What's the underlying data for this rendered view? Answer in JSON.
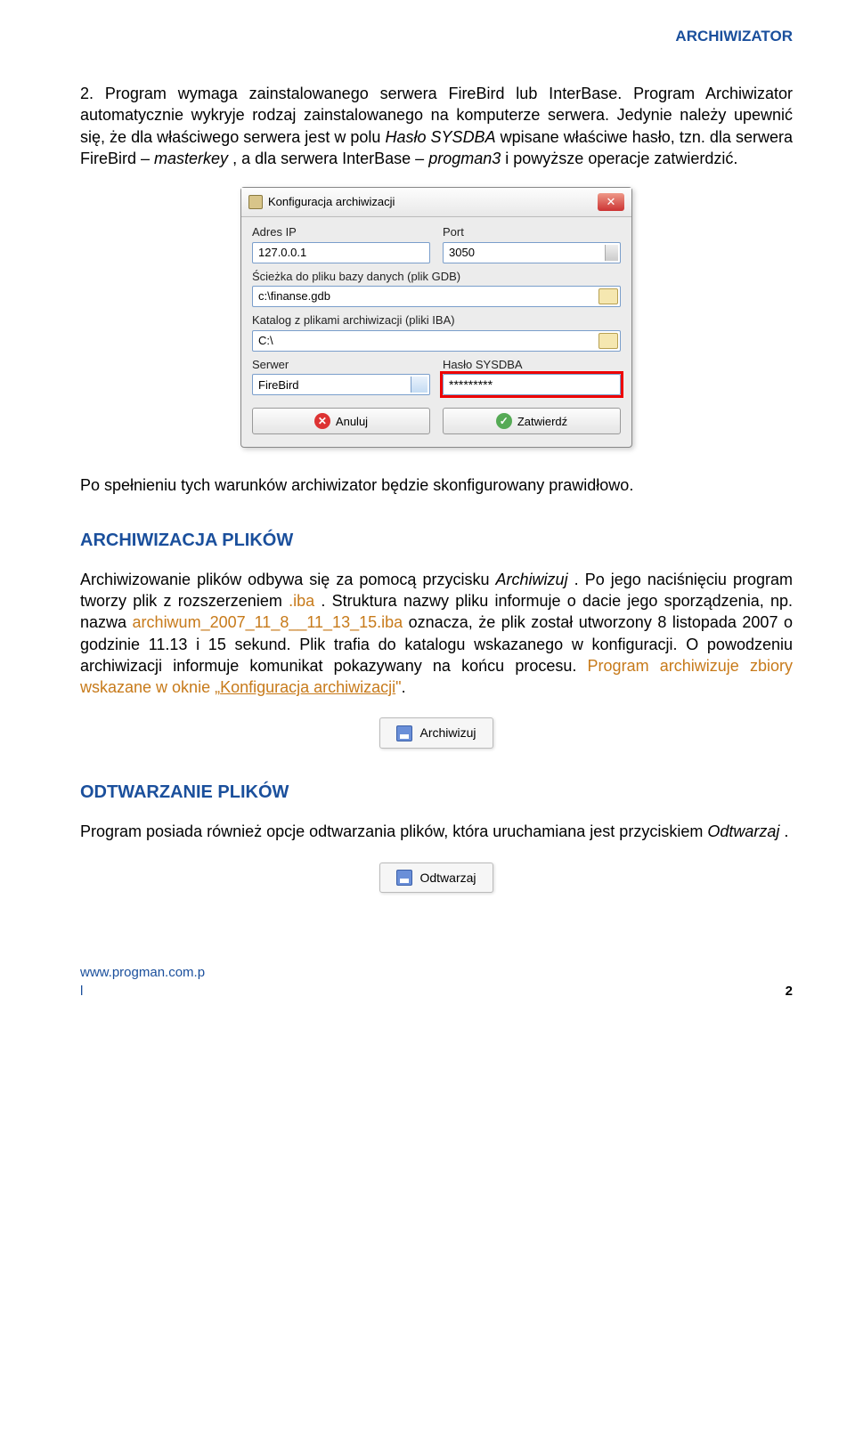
{
  "header": {
    "right": "ARCHIWIZATOR"
  },
  "p1_prefix": "2. Program wymaga zainstalowanego serwera FireBird lub InterBase. Program Archiwizator automatycznie wykryje rodzaj zainstalowanego na komputerze serwera. Jedynie należy upewnić się, że dla właściwego serwera jest w polu ",
  "p1_i1": "Hasło SYSDBA",
  "p1_mid1": " wpisane właściwe hasło, tzn. dla serwera FireBird – ",
  "p1_i2": "masterkey",
  "p1_mid2": ", a dla serwera InterBase – ",
  "p1_i3": "progman3",
  "p1_suffix": " i powyższe operacje zatwierdzić.",
  "dialog": {
    "title": "Konfiguracja archiwizacji",
    "lbl_ip": "Adres IP",
    "val_ip": "127.0.0.1",
    "lbl_port": "Port",
    "val_port": "3050",
    "lbl_path": "Ścieżka do pliku bazy danych (plik GDB)",
    "val_path": "c:\\finanse.gdb",
    "lbl_dir": "Katalog z plikami archiwizacji (pliki IBA)",
    "val_dir": "C:\\",
    "lbl_server": "Serwer",
    "val_server": "FireBird",
    "lbl_pass": "Hasło SYSDBA",
    "val_pass": "*********",
    "btn_cancel": "Anuluj",
    "btn_ok": "Zatwierdź"
  },
  "p2": "Po spełnieniu tych warunków archiwizator będzie skonfigurowany prawidłowo.",
  "sec1_title": "ARCHIWIZACJA PLIKÓW",
  "p3_a": "Archiwizowanie plików odbywa się za pomocą przycisku ",
  "p3_i1": "Archiwizuj",
  "p3_b": ". Po jego naciśnięciu program tworzy plik z rozszerzeniem ",
  "p3_ext": ".iba",
  "p3_c": ". Struktura nazwy pliku informuje o dacie jego sporządzenia, np. nazwa ",
  "p3_file": "archiwum_2007_11_8__11_13_15.iba",
  "p3_d": " oznacza, że plik został utworzony 8 listopada 2007 o godzinie 11.13 i 15 sekund. Plik trafia do katalogu wskazanego w konfiguracji. O powodzeniu archiwizacji informuje komunikat pokazywany na końcu procesu. ",
  "p3_orange": "Program archiwizuje zbiory wskazane w oknie „",
  "p3_link": "Konfiguracja archiwizacji",
  "p3_orange2": ".",
  "btn_arch": "Archiwizuj",
  "sec2_title": "ODTWARZANIE PLIKÓW",
  "p4_a": "Program posiada również opcje odtwarzania plików, która uruchamiana jest przyciskiem ",
  "p4_i1": "Odtwarzaj",
  "p4_b": ".",
  "btn_restore": "Odtwarzaj",
  "footer": {
    "left1": "www.progman.com.p",
    "left2": "l",
    "right": "2"
  }
}
